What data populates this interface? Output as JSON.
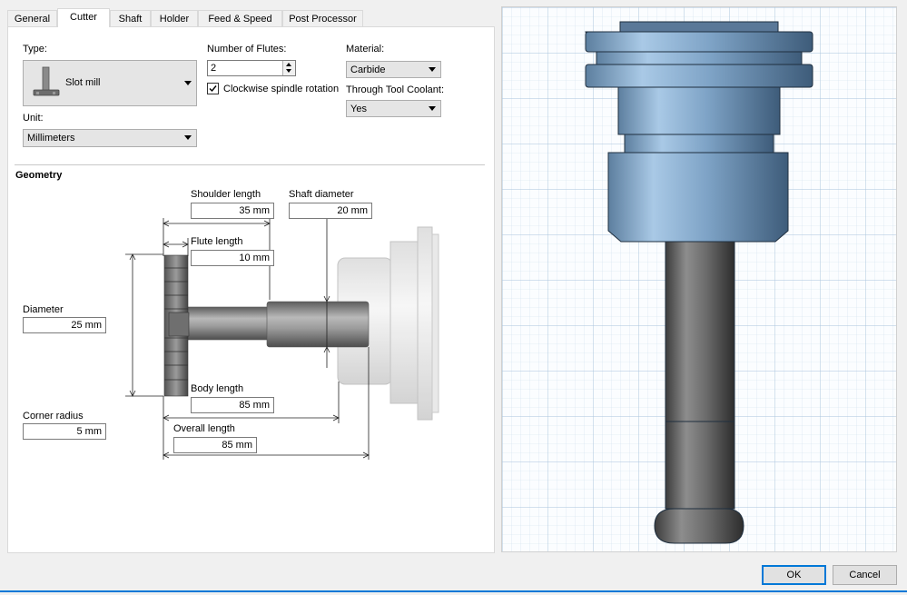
{
  "tabs": [
    {
      "label": "General"
    },
    {
      "label": "Cutter"
    },
    {
      "label": "Shaft"
    },
    {
      "label": "Holder"
    },
    {
      "label": "Feed & Speed"
    },
    {
      "label": "Post Processor"
    }
  ],
  "active_tab": "Cutter",
  "cutter": {
    "type_label": "Type:",
    "type_value": "Slot mill",
    "unit_label": "Unit:",
    "unit_value": "Millimeters",
    "flutes_label": "Number of Flutes:",
    "flutes_value": "2",
    "clockwise_label": "Clockwise spindle rotation",
    "clockwise_checked": true,
    "material_label": "Material:",
    "material_value": "Carbide",
    "coolant_label": "Through Tool Coolant:",
    "coolant_value": "Yes"
  },
  "geometry": {
    "title": "Geometry",
    "shoulder_length_label": "Shoulder length",
    "shoulder_length_value": "35 mm",
    "shaft_diameter_label": "Shaft diameter",
    "shaft_diameter_value": "20 mm",
    "flute_length_label": "Flute length",
    "flute_length_value": "10 mm",
    "diameter_label": "Diameter",
    "diameter_value": "25 mm",
    "body_length_label": "Body length",
    "body_length_value": "85 mm",
    "corner_radius_label": "Corner radius",
    "corner_radius_value": "5 mm",
    "overall_length_label": "Overall length",
    "overall_length_value": "85 mm"
  },
  "buttons": {
    "ok": "OK",
    "cancel": "Cancel"
  },
  "colors": {
    "accent": "#0078d7",
    "grid": "#b9d2e6",
    "holder_blue": "#8fb3d4"
  }
}
